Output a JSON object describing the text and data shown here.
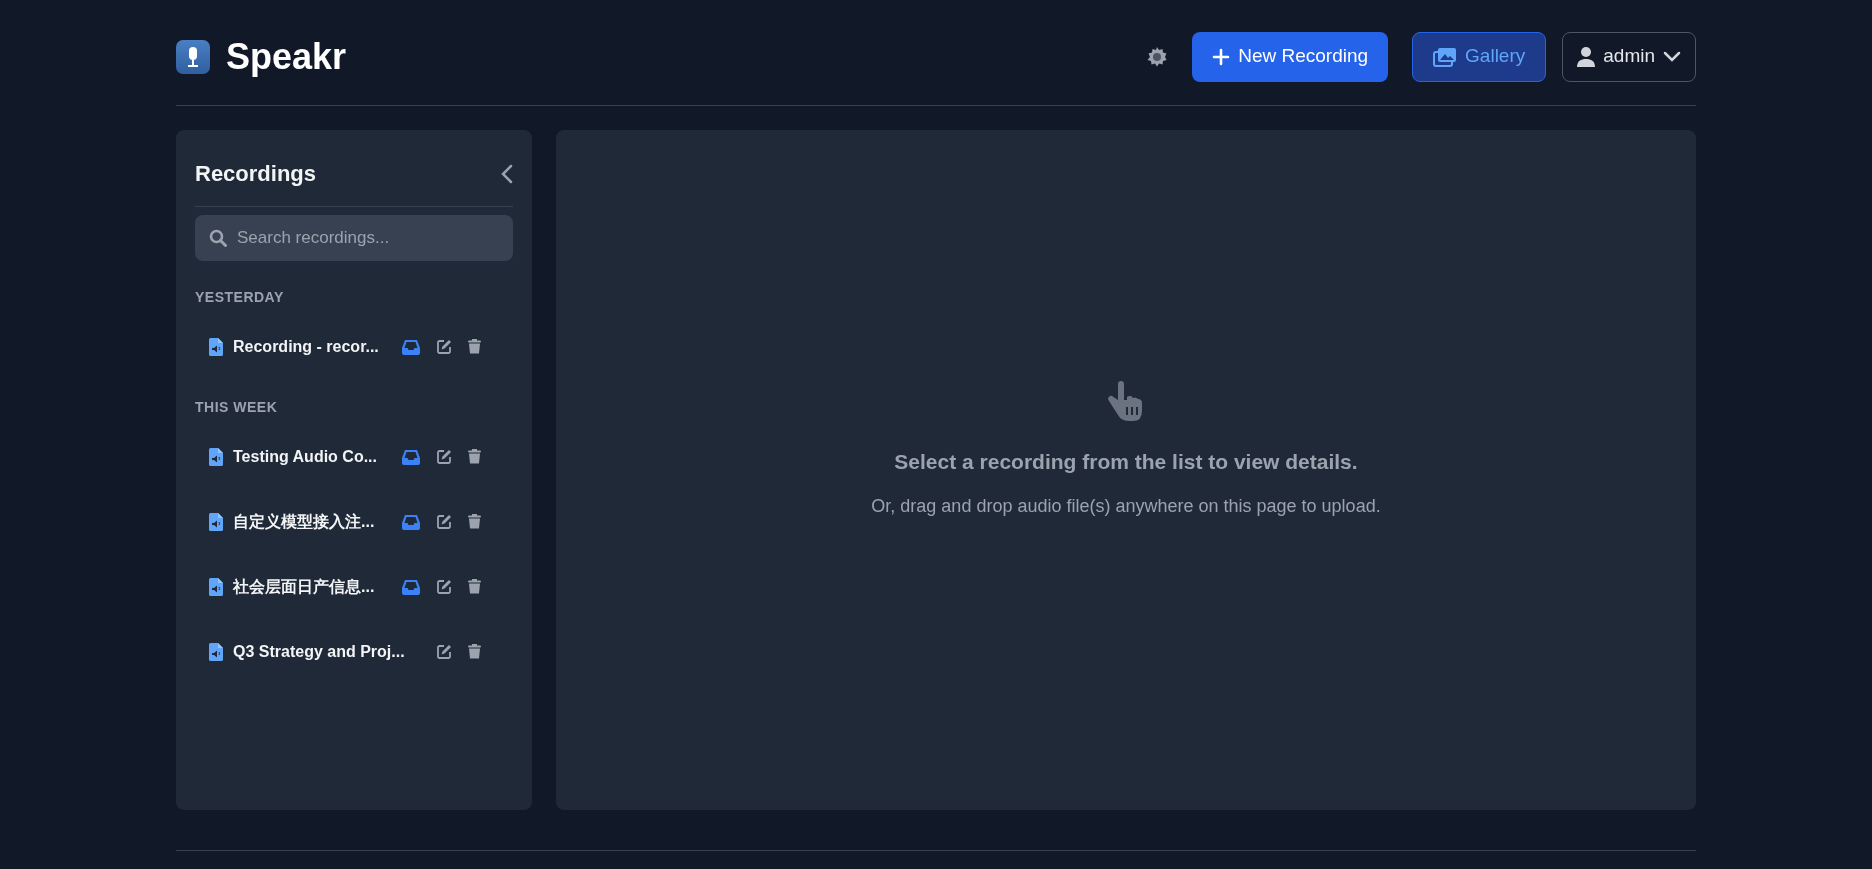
{
  "header": {
    "app_name": "Speakr",
    "new_recording": "New Recording",
    "gallery": "Gallery",
    "user": "admin"
  },
  "sidebar": {
    "title": "Recordings",
    "search": {
      "placeholder": "Search recordings..."
    },
    "groups": [
      {
        "label": "YESTERDAY",
        "items": [
          {
            "title": "Recording - recor...",
            "inbox": true
          }
        ]
      },
      {
        "label": "THIS WEEK",
        "items": [
          {
            "title": "Testing Audio Co...",
            "inbox": true
          },
          {
            "title": "自定义模型接入注...",
            "inbox": true
          },
          {
            "title": "社会层面日产信息...",
            "inbox": true
          },
          {
            "title": "Q3 Strategy and Proj...",
            "inbox": false
          }
        ]
      }
    ]
  },
  "main": {
    "message": "Select a recording from the list to view details.",
    "hint": "Or, drag and drop audio file(s) anywhere on this page to upload."
  }
}
